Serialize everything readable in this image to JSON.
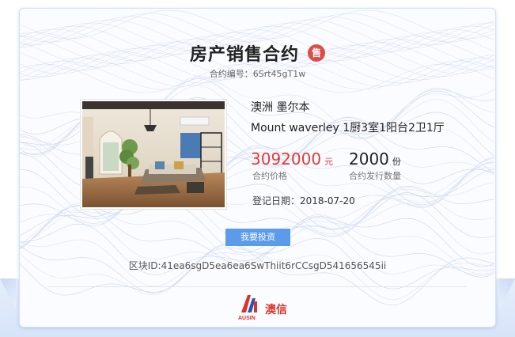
{
  "contract": {
    "title": "房产销售合约",
    "badge": "售",
    "number_label": "合约编号：",
    "number": "6Srt45gT1w"
  },
  "property": {
    "location": "澳洲 墨尔本",
    "name": "Mount waverley 1厨3室1阳台2卫1厅",
    "image_icon": "apartment-photo"
  },
  "price": {
    "value": "3092000",
    "unit": "元",
    "label": "合约价格"
  },
  "shares": {
    "value": "2000",
    "unit": "份",
    "label": "合约发行数量"
  },
  "registration": {
    "label": "登记日期：",
    "date": "2018-07-20"
  },
  "actions": {
    "invest_label": "我要投资"
  },
  "block": {
    "label": "区块ID:",
    "id": "41ea6sgD5ea6ea6SwThiit6rCCsgD541656545ii"
  },
  "brand": {
    "name": "澳信",
    "logo_text": "AUSIN"
  },
  "colors": {
    "accent_red": "#e03b3b",
    "button_blue": "#5c9be9",
    "badge_red": "#e24a4a",
    "logo_red": "#d9342b"
  }
}
